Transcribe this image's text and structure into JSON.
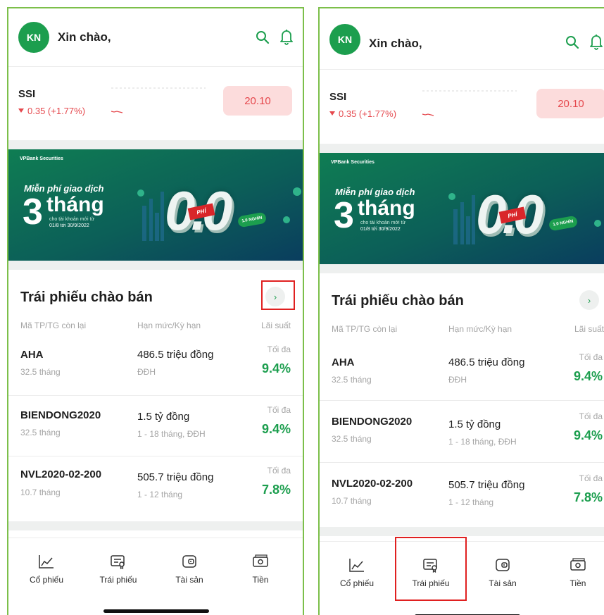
{
  "colors": {
    "brand_green": "#1c9e4e",
    "price_down": "#e5484d",
    "price_box_bg": "#fcdcdc",
    "panel_border": "#7cbf4a",
    "highlight": "#e02020"
  },
  "header": {
    "avatar_initials": "KN",
    "greeting": "Xin chào,"
  },
  "stock": {
    "ticker": "SSI",
    "change": "0.35 (+1.77%)",
    "price": "20.10"
  },
  "banner": {
    "brand": "VPBank Securities",
    "line1": "Miễn phí giao dịch",
    "number": "3",
    "word": "tháng",
    "sub1": "cho tài khoản mới từ",
    "sub2": "01/8 tới 30/9/2022",
    "big": "0.0",
    "phi": "PHÍ",
    "tag": "1.0 NGHÌN"
  },
  "bonds": {
    "title": "Trái phiếu chào bán",
    "columns": [
      "Mã TP/TG còn lại",
      "Hạn mức/Kỳ hạn",
      "Lãi suất"
    ],
    "rows": [
      {
        "code": "AHA",
        "term": "32.5 tháng",
        "amount": "486.5 triệu đồng",
        "type": "ĐĐH",
        "max_label": "Tối đa",
        "rate": "9.4%"
      },
      {
        "code": "BIENDONG2020",
        "term": "32.5 tháng",
        "amount": "1.5 tỷ đồng",
        "type": "1 - 18 tháng, ĐĐH",
        "max_label": "Tối đa",
        "rate": "9.4%"
      },
      {
        "code": "NVL2020-02-200",
        "term": "10.7 tháng",
        "amount": "505.7 triệu đồng",
        "type": "1 - 12 tháng",
        "max_label": "Tối đa",
        "rate": "7.8%"
      }
    ]
  },
  "nav": [
    {
      "label": "Cổ phiếu",
      "icon": "chart-line-icon"
    },
    {
      "label": "Trái phiếu",
      "icon": "bond-certificate-icon"
    },
    {
      "label": "Tài sản",
      "icon": "wallet-icon"
    },
    {
      "label": "Tiền",
      "icon": "money-icon"
    }
  ]
}
